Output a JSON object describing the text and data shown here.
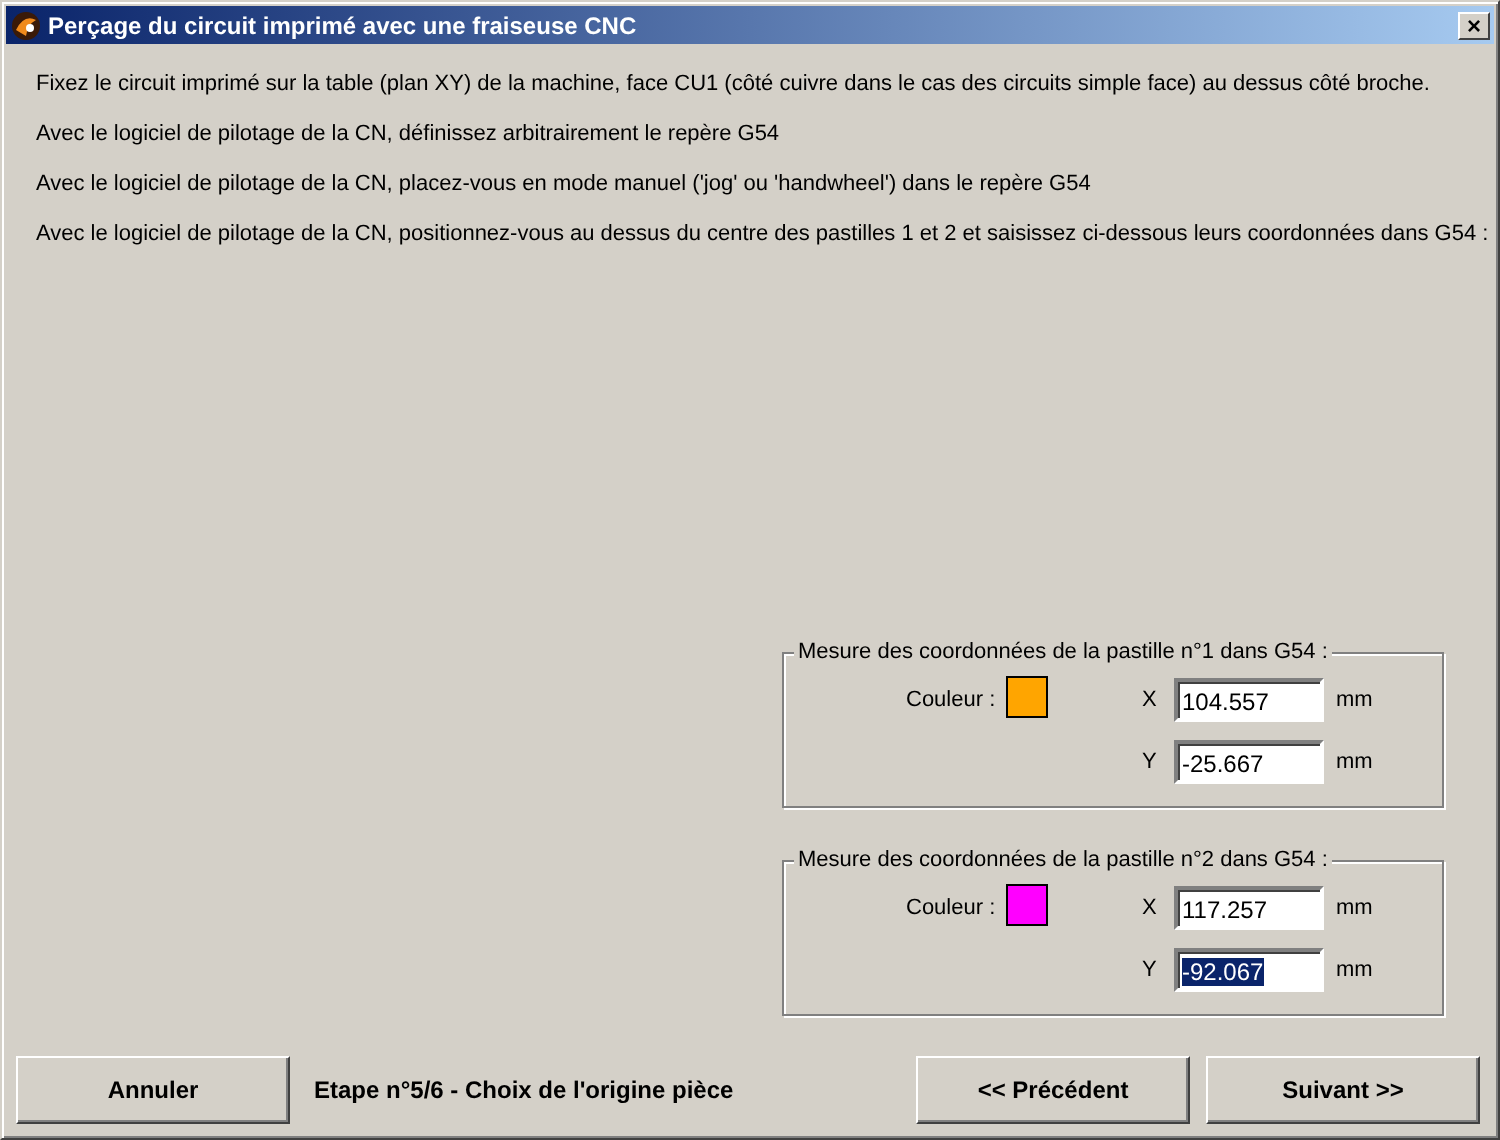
{
  "window": {
    "title": "Perçage du circuit imprimé avec une fraiseuse CNC",
    "close": "×"
  },
  "instructions": [
    "Fixez le circuit imprimé sur la table (plan XY) de la machine, face CU1 (côté cuivre dans le cas des circuits simple face) au dessus côté broche.",
    "Avec le logiciel de pilotage de la CN, définissez arbitrairement le repère G54",
    "Avec le logiciel de pilotage de la CN, placez-vous en mode manuel ('jog' ou 'handwheel') dans le repère G54",
    "Avec le logiciel de pilotage de la CN, positionnez-vous au dessus du centre des pastilles 1 et 2 et saisissez ci-dessous leurs coordonnées dans G54 :"
  ],
  "groups": [
    {
      "title": "Mesure des coordonnées de la pastille n°1 dans G54 :",
      "color_label": "Couleur :",
      "color": "#ffa500",
      "fields": [
        {
          "axis": "X",
          "value": "104.557",
          "unit": "mm",
          "selected": false
        },
        {
          "axis": "Y",
          "value": "-25.667",
          "unit": "mm",
          "selected": false
        }
      ]
    },
    {
      "title": "Mesure des coordonnées de la pastille n°2 dans G54 :",
      "color_label": "Couleur :",
      "color": "#ff00ff",
      "fields": [
        {
          "axis": "X",
          "value": "117.257",
          "unit": "mm",
          "selected": false
        },
        {
          "axis": "Y",
          "value": "-92.067",
          "unit": "mm",
          "selected": true
        }
      ]
    }
  ],
  "footer": {
    "cancel": "Annuler",
    "step": "Etape n°5/6 - Choix de l'origine pièce",
    "previous": "<< Précédent",
    "next": "Suivant >>"
  }
}
